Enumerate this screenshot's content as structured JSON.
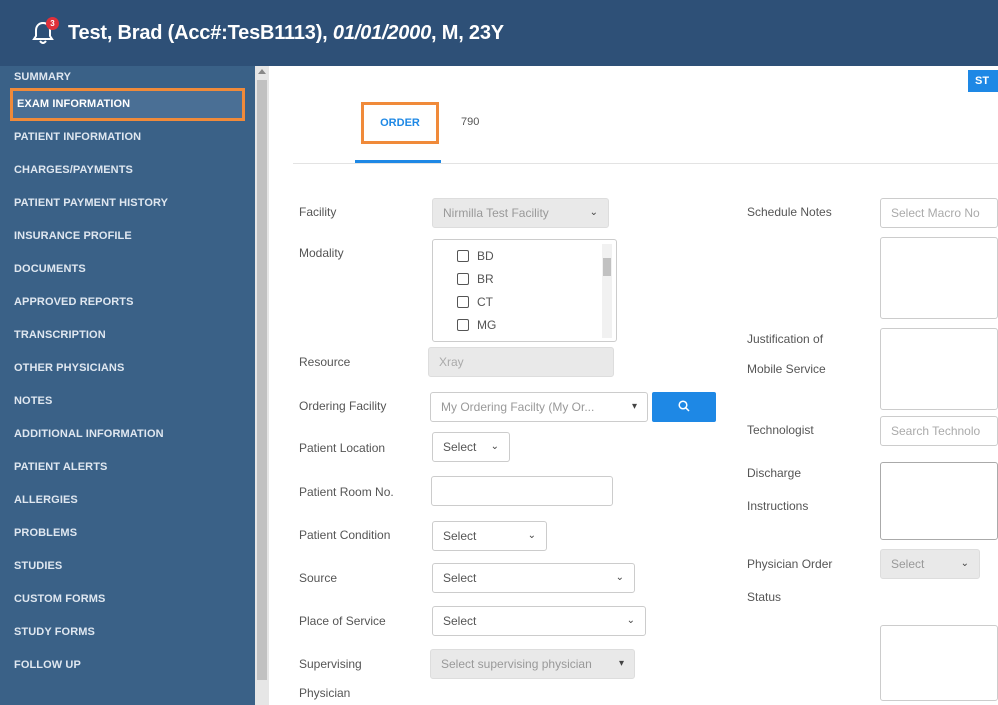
{
  "header": {
    "notifications_count": "3",
    "patient_name": "Test, Brad (Acc#:TesB1113),",
    "dob": "01/01/2000",
    "demographics": ", M, 23Y"
  },
  "sidebar": {
    "items": [
      {
        "label": "SUMMARY"
      },
      {
        "label": "EXAM INFORMATION"
      },
      {
        "label": "PATIENT INFORMATION"
      },
      {
        "label": "CHARGES/PAYMENTS"
      },
      {
        "label": "PATIENT PAYMENT HISTORY"
      },
      {
        "label": "INSURANCE PROFILE"
      },
      {
        "label": "DOCUMENTS"
      },
      {
        "label": "APPROVED REPORTS"
      },
      {
        "label": "TRANSCRIPTION"
      },
      {
        "label": "OTHER PHYSICIANS"
      },
      {
        "label": "NOTES"
      },
      {
        "label": "ADDITIONAL INFORMATION"
      },
      {
        "label": "PATIENT ALERTS"
      },
      {
        "label": "ALLERGIES"
      },
      {
        "label": "PROBLEMS"
      },
      {
        "label": "STUDIES"
      },
      {
        "label": "CUSTOM FORMS"
      },
      {
        "label": "STUDY FORMS"
      },
      {
        "label": "FOLLOW UP"
      }
    ]
  },
  "main": {
    "top_button": "ST",
    "tabs": [
      {
        "label": "ORDER"
      },
      {
        "label": "790"
      }
    ],
    "left": {
      "facility_label": "Facility",
      "facility_value": "Nirmilla Test Facility",
      "modality_label": "Modality",
      "modality_options": [
        "BD",
        "BR",
        "CT",
        "MG"
      ],
      "resource_label": "Resource",
      "resource_value": "Xray",
      "ordering_facility_label": "Ordering Facility",
      "ordering_facility_value": "My Ordering Facilty (My Or...",
      "patient_location_label": "Patient Location",
      "patient_location_value": "Select",
      "room_label": "Patient Room No.",
      "condition_label": "Patient Condition",
      "condition_value": "Select",
      "source_label": "Source",
      "source_value": "Select",
      "pos_label": "Place of Service",
      "pos_value": "Select",
      "supervising_label_1": "Supervising",
      "supervising_label_2": "Physician",
      "supervising_placeholder": "Select supervising physician"
    },
    "right": {
      "schedule_notes_label": "Schedule Notes",
      "schedule_notes_placeholder": "Select Macro No",
      "justification_label_1": "Justification of",
      "justification_label_2": "Mobile Service",
      "technologist_label": "Technologist",
      "technologist_placeholder": "Search Technolo",
      "discharge_label_1": "Discharge",
      "discharge_label_2": "Instructions",
      "physician_order_label_1": "Physician Order",
      "physician_order_label_2": "Status",
      "physician_order_value": "Select"
    }
  }
}
